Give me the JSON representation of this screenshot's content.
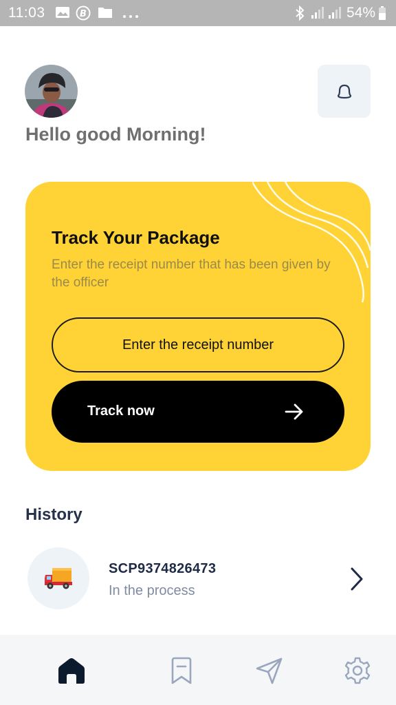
{
  "status_bar": {
    "time": "11:03",
    "battery": "54%",
    "icons": [
      "image-icon",
      "b-circle-icon",
      "folder-icon",
      "more-dots-icon",
      "bluetooth-icon",
      "signal-icon",
      "signal-icon",
      "battery-icon"
    ]
  },
  "header": {
    "greeting": "Hello good Morning!",
    "avatar_icon": "user-avatar",
    "notification_icon": "bell-icon"
  },
  "track_card": {
    "title": "Track Your Package",
    "description": "Enter the receipt number that has been given by the officer",
    "input_placeholder": "Enter the receipt number",
    "button_label": "Track now",
    "button_icon": "arrow-right-icon",
    "background_color": "#ffd335"
  },
  "history": {
    "title": "History",
    "items": [
      {
        "code": "SCP9374826473",
        "status": "In the process",
        "icon": "truck-icon"
      }
    ]
  },
  "bottom_nav": {
    "items": [
      {
        "name": "home",
        "icon": "home-icon",
        "active": true
      },
      {
        "name": "bookmark",
        "icon": "bookmark-icon",
        "active": false
      },
      {
        "name": "send",
        "icon": "send-icon",
        "active": false
      },
      {
        "name": "settings",
        "icon": "gear-icon",
        "active": false
      }
    ]
  },
  "colors": {
    "accent": "#ffd335",
    "dark": "#000000",
    "text_primary": "#1e2a46",
    "text_muted": "#7f8aa3"
  }
}
